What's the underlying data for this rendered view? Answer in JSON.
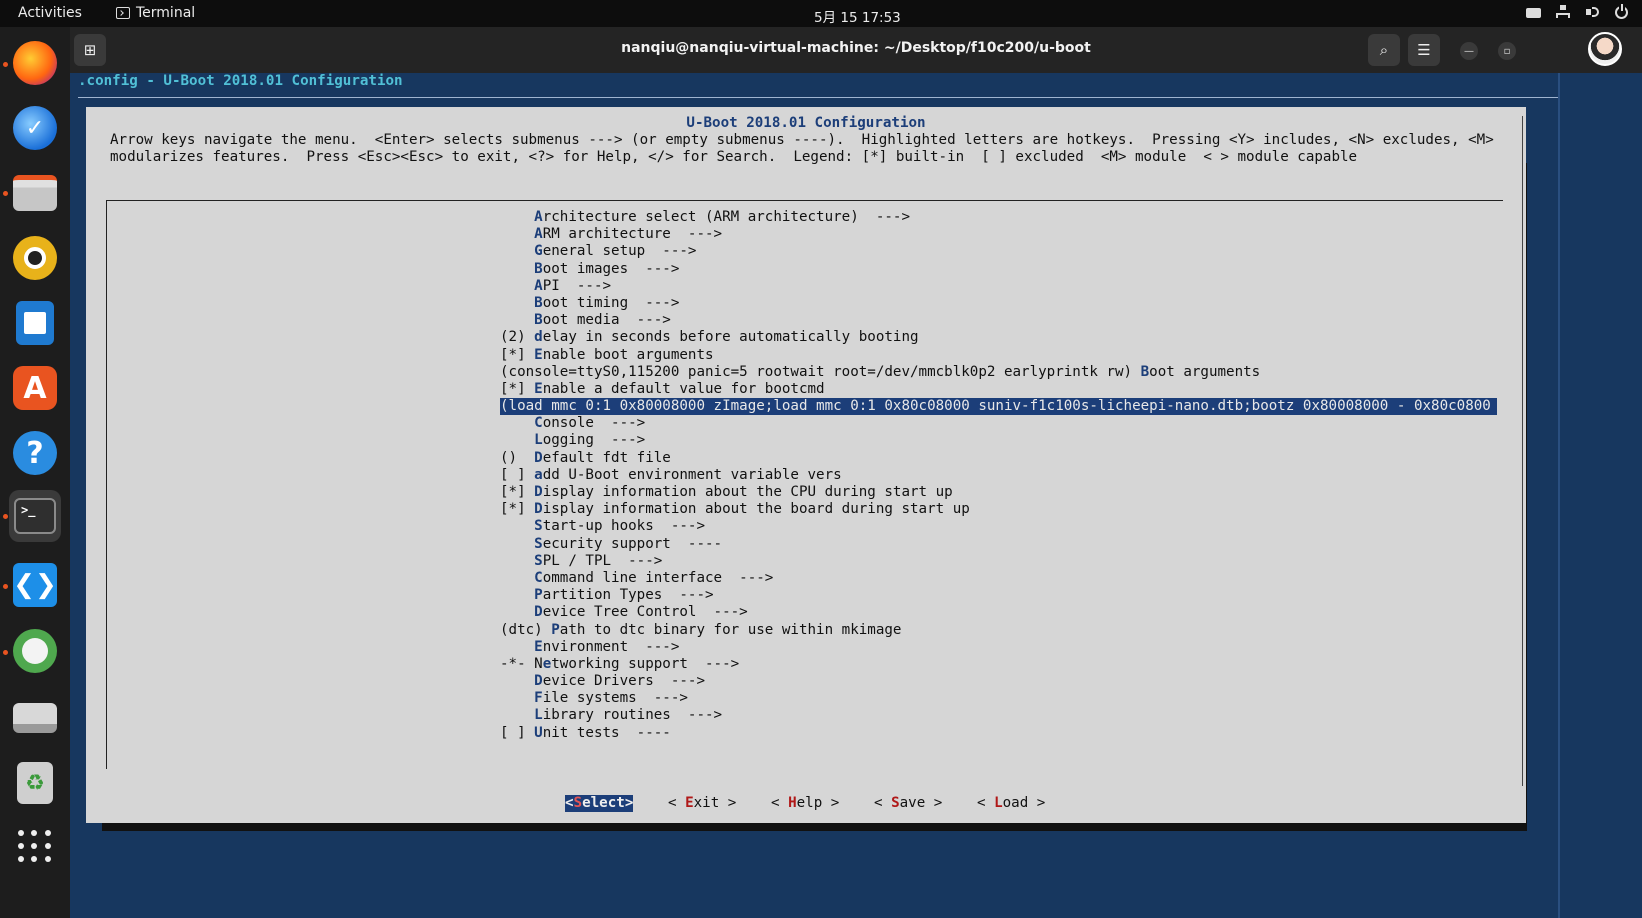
{
  "topbar": {
    "activities": "Activities",
    "app_name": "Terminal",
    "clock": "5月 15  17:53"
  },
  "window": {
    "title": "nanqiu@nanqiu-virtual-machine: ~/Desktop/f10c200/u-boot"
  },
  "terminal": {
    "config_title": ".config - U-Boot 2018.01 Configuration",
    "dialog_title": "U-Boot 2018.01 Configuration",
    "help_line1": "Arrow keys navigate the menu.  <Enter> selects submenus ---> (or empty submenus ----).  Highlighted letters are hotkeys.  Pressing <Y> includes, <N> excludes, <M>",
    "help_line2": "modularizes features.  Press <Esc><Esc> to exit, <?> for Help, </> for Search.  Legend: [*] built-in  [ ] excluded  <M> module  < > module capable",
    "menu_items": [
      {
        "prefix": "    ",
        "hotkey": "A",
        "rest": "rchitecture select (ARM architecture)  --->"
      },
      {
        "prefix": "    ",
        "hotkey": "A",
        "rest": "RM architecture  --->"
      },
      {
        "prefix": "    ",
        "hotkey": "G",
        "rest": "eneral setup  --->"
      },
      {
        "prefix": "    ",
        "hotkey": "B",
        "rest": "oot images  --->"
      },
      {
        "prefix": "    ",
        "hotkey": "A",
        "rest": "PI  --->"
      },
      {
        "prefix": "    ",
        "hotkey": "B",
        "rest": "oot timing  --->"
      },
      {
        "prefix": "    ",
        "hotkey": "B",
        "rest": "oot media  --->"
      },
      {
        "prefix": "(2) ",
        "hotkey": "d",
        "rest": "elay in seconds before automatically booting"
      },
      {
        "prefix": "[*] ",
        "hotkey": "E",
        "rest": "nable boot arguments"
      },
      {
        "prefix": "(console=ttyS0,115200 panic=5 rootwait root=/dev/mmcblk0p2 earlyprintk rw) ",
        "hotkey": "B",
        "rest": "oot arguments"
      },
      {
        "prefix": "[*] ",
        "hotkey": "E",
        "rest": "nable a default value for bootcmd"
      },
      {
        "prefix": "(load mmc 0:1 0x80008000 zImage;load mmc 0:1 0x80c08000 suniv-f1c100s-licheepi-nano.dtb;bootz 0x80008000 - 0x80c0800",
        "hotkey": "",
        "rest": "",
        "selected": true
      },
      {
        "prefix": "    ",
        "hotkey": "C",
        "rest": "onsole  --->"
      },
      {
        "prefix": "    ",
        "hotkey": "L",
        "rest": "ogging  --->"
      },
      {
        "prefix": "()  ",
        "hotkey": "D",
        "rest": "efault fdt file"
      },
      {
        "prefix": "[ ] ",
        "hotkey": "a",
        "rest": "dd U-Boot environment variable vers"
      },
      {
        "prefix": "[*] ",
        "hotkey": "D",
        "rest": "isplay information about the CPU during start up"
      },
      {
        "prefix": "[*] ",
        "hotkey": "D",
        "rest": "isplay information about the board during start up"
      },
      {
        "prefix": "    ",
        "hotkey": "S",
        "rest": "tart-up hooks  --->"
      },
      {
        "prefix": "    ",
        "hotkey": "S",
        "rest": "ecurity support  ----"
      },
      {
        "prefix": "    ",
        "hotkey": "S",
        "rest": "PL / TPL  --->"
      },
      {
        "prefix": "    ",
        "hotkey": "C",
        "rest": "ommand line interface  --->"
      },
      {
        "prefix": "    ",
        "hotkey": "P",
        "rest": "artition Types  --->"
      },
      {
        "prefix": "    ",
        "hotkey": "D",
        "rest": "evice Tree Control  --->"
      },
      {
        "prefix": "(dtc) ",
        "hotkey": "P",
        "rest": "ath to dtc binary for use within mkimage"
      },
      {
        "prefix": "    ",
        "hotkey": "E",
        "rest": "nvironment  --->"
      },
      {
        "prefix": "-*- N",
        "hotkey": "e",
        "rest": "tworking support  --->"
      },
      {
        "prefix": "    ",
        "hotkey": "D",
        "rest": "evice Drivers  --->"
      },
      {
        "prefix": "    ",
        "hotkey": "F",
        "rest": "ile systems  --->"
      },
      {
        "prefix": "    ",
        "hotkey": "L",
        "rest": "ibrary routines  --->"
      },
      {
        "prefix": "[ ] ",
        "hotkey": "U",
        "rest": "nit tests  ----"
      }
    ],
    "buttons": [
      {
        "open": "<",
        "hotkey": "S",
        "rest": "elect",
        "close": ">",
        "selected": true
      },
      {
        "open": "< ",
        "hotkey": "E",
        "rest": "xit",
        "close": " >"
      },
      {
        "open": "< ",
        "hotkey": "H",
        "rest": "elp",
        "close": " >"
      },
      {
        "open": "< ",
        "hotkey": "S",
        "rest": "ave",
        "close": " >"
      },
      {
        "open": "< ",
        "hotkey": "L",
        "rest": "oad",
        "close": " >"
      }
    ]
  },
  "dock": {
    "items": [
      "firefox-icon",
      "thunderbird-icon",
      "files-icon",
      "rhythmbox-icon",
      "writer-icon",
      "app-center-icon",
      "help-icon",
      "terminal-icon",
      "vscode-icon",
      "disk-usage-icon",
      "drive-icon",
      "trash-icon",
      "show-apps-icon"
    ]
  },
  "colors": {
    "dialog_bg": "#d6d6d6",
    "terminal_bg": "#17375f",
    "highlight": "#1c3e79",
    "hotkey_red": "#b01818",
    "config_title": "#51c0d6"
  }
}
